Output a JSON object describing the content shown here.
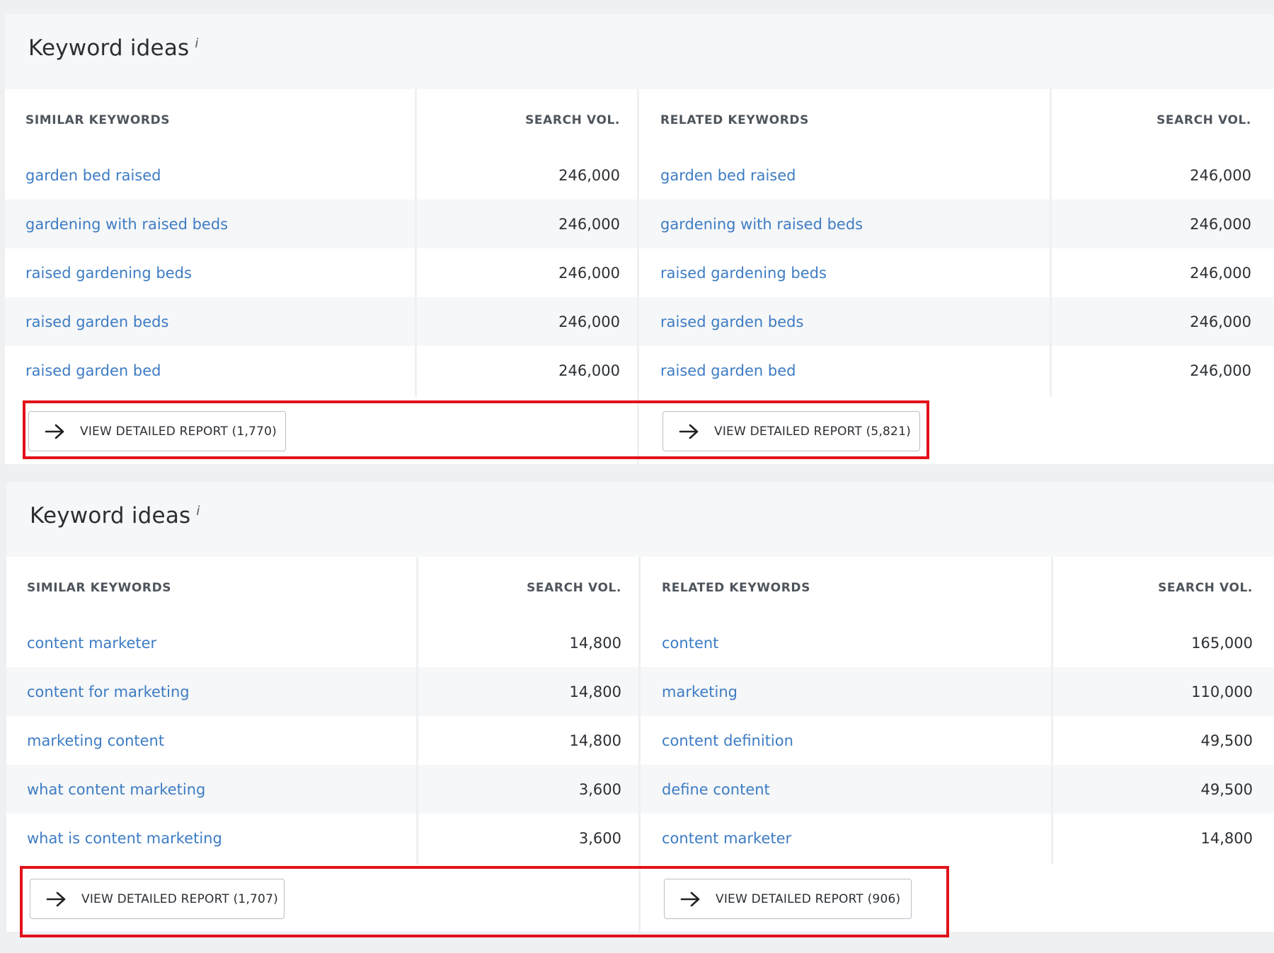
{
  "panels": [
    {
      "title": "Keyword ideas",
      "info_mark": "i",
      "headers": {
        "similar": "SIMILAR KEYWORDS",
        "similar_vol": "SEARCH VOL.",
        "related": "RELATED KEYWORDS",
        "related_vol": "SEARCH VOL."
      },
      "rows": [
        {
          "similar": "garden bed raised",
          "similar_vol": "246,000",
          "related": "garden bed raised",
          "related_vol": "246,000"
        },
        {
          "similar": "gardening with raised beds",
          "similar_vol": "246,000",
          "related": "gardening with raised beds",
          "related_vol": "246,000"
        },
        {
          "similar": "raised gardening beds",
          "similar_vol": "246,000",
          "related": "raised gardening beds",
          "related_vol": "246,000"
        },
        {
          "similar": "raised garden beds",
          "similar_vol": "246,000",
          "related": "raised garden beds",
          "related_vol": "246,000"
        },
        {
          "similar": "raised garden bed",
          "similar_vol": "246,000",
          "related": "raised garden bed",
          "related_vol": "246,000"
        }
      ],
      "buttons": {
        "similar": "VIEW DETAILED REPORT (1,770)",
        "related": "VIEW DETAILED REPORT (5,821)"
      }
    },
    {
      "title": "Keyword ideas",
      "info_mark": "i",
      "headers": {
        "similar": "SIMILAR KEYWORDS",
        "similar_vol": "SEARCH VOL.",
        "related": "RELATED KEYWORDS",
        "related_vol": "SEARCH VOL."
      },
      "rows": [
        {
          "similar": "content marketer",
          "similar_vol": "14,800",
          "related": "content",
          "related_vol": "165,000"
        },
        {
          "similar": "content for marketing",
          "similar_vol": "14,800",
          "related": "marketing",
          "related_vol": "110,000"
        },
        {
          "similar": "marketing content",
          "similar_vol": "14,800",
          "related": "content definition",
          "related_vol": "49,500"
        },
        {
          "similar": "what content marketing",
          "similar_vol": "3,600",
          "related": "define content",
          "related_vol": "49,500"
        },
        {
          "similar": "what is content marketing",
          "similar_vol": "3,600",
          "related": "content marketer",
          "related_vol": "14,800"
        }
      ],
      "buttons": {
        "similar": "VIEW DETAILED REPORT (1,707)",
        "related": "VIEW DETAILED REPORT (906)"
      }
    }
  ],
  "colors": {
    "link": "#3d7cc4",
    "highlight": "#e2121b",
    "text": "#2b2f33",
    "header": "#4e555c"
  },
  "icons": {
    "button_arrow": "arrow-right-icon",
    "title_info": "info-icon"
  }
}
